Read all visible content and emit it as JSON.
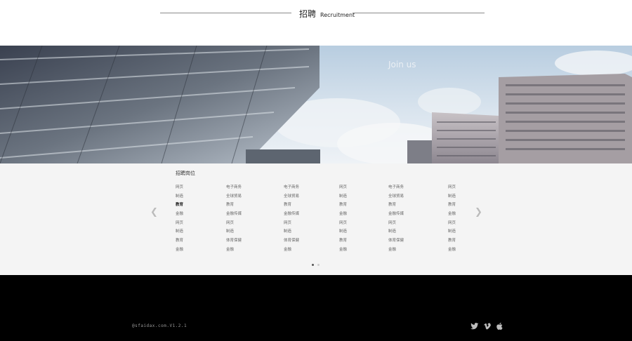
{
  "header": {
    "title_cn": "招聘",
    "title_en": "Recruitment"
  },
  "banner": {
    "caption": "Join us"
  },
  "jobs": {
    "section_title": "招聘岗位",
    "columns": [
      [
        "网页",
        "制造",
        "教育",
        "金融",
        "网页",
        "制造",
        "教育",
        "金融"
      ],
      [
        "电子商务",
        "全球贸易",
        "教育",
        "金融传媒",
        "网页",
        "制造",
        "体育保健",
        "金融"
      ],
      [
        "电子商务",
        "全球贸易",
        "教育",
        "金融传媒",
        "网页",
        "制造",
        "体育保健",
        "金融"
      ],
      [
        "网页",
        "制造",
        "教育",
        "金融",
        "网页",
        "制造",
        "教育",
        "金融"
      ],
      [
        "电子商务",
        "全球贸易",
        "教育",
        "金融传媒",
        "网页",
        "制造",
        "体育保健",
        "金融"
      ],
      [
        "网页",
        "制造",
        "教育",
        "金融",
        "网页",
        "制造",
        "教育",
        "金融"
      ]
    ],
    "prev_icon": "chevron-left-icon",
    "next_icon": "chevron-right-icon",
    "pagination": {
      "pages": 2,
      "current": 1
    }
  },
  "footer": {
    "copyright": "@sfaidax.com.V1.2.1",
    "social_icons": [
      "twitter-icon",
      "vimeo-icon",
      "apple-icon"
    ]
  }
}
